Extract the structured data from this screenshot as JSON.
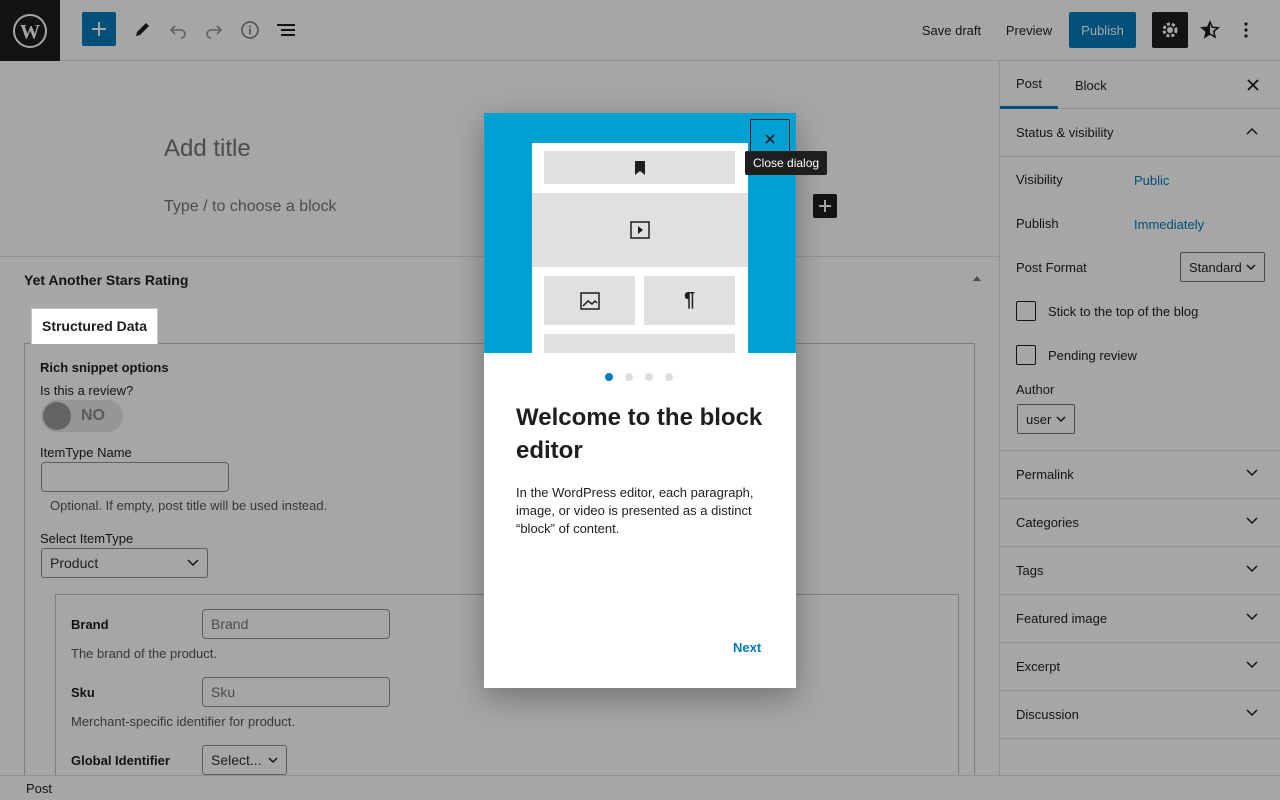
{
  "toolbar": {
    "save_draft": "Save draft",
    "preview": "Preview",
    "publish": "Publish"
  },
  "editor": {
    "title_placeholder": "Add title",
    "block_placeholder": "Type / to choose a block"
  },
  "metabox": {
    "title": "Yet Another Stars Rating",
    "tab": "Structured Data",
    "rich_snippet_title": "Rich snippet options",
    "review_question": "Is this a review?",
    "review_toggle": "NO",
    "itemtype_name_label": "ItemType Name",
    "itemtype_name_help": "Optional. If empty, post title will be used instead.",
    "select_itemtype_label": "Select ItemType",
    "select_itemtype_value": "Product",
    "brand_label": "Brand",
    "brand_placeholder": "Brand",
    "brand_help": "The brand of the product.",
    "sku_label": "Sku",
    "sku_placeholder": "Sku",
    "sku_help": "Merchant-specific identifier for product.",
    "global_id_label": "Global Identifier",
    "global_id_value": "Select..."
  },
  "sidebar": {
    "tab_post": "Post",
    "tab_block": "Block",
    "status_visibility": "Status & visibility",
    "visibility_label": "Visibility",
    "visibility_value": "Public",
    "publish_label": "Publish",
    "publish_value": "Immediately",
    "post_format_label": "Post Format",
    "post_format_value": "Standard",
    "stick_top": "Stick to the top of the blog",
    "pending_review": "Pending review",
    "author_label": "Author",
    "author_value": "user",
    "sections": [
      "Permalink",
      "Categories",
      "Tags",
      "Featured image",
      "Excerpt",
      "Discussion"
    ]
  },
  "footer": {
    "breadcrumb": "Post"
  },
  "modal": {
    "tooltip": "Close dialog",
    "heading": "Welcome to the block editor",
    "body": "In the WordPress editor, each paragraph, image, or video is presented as a distinct “block” of content.",
    "next": "Next",
    "page_count": 4,
    "current_page": 1
  },
  "colors": {
    "accent": "#007cba",
    "hero": "#00a0d2",
    "dark": "#1e1e1e"
  }
}
